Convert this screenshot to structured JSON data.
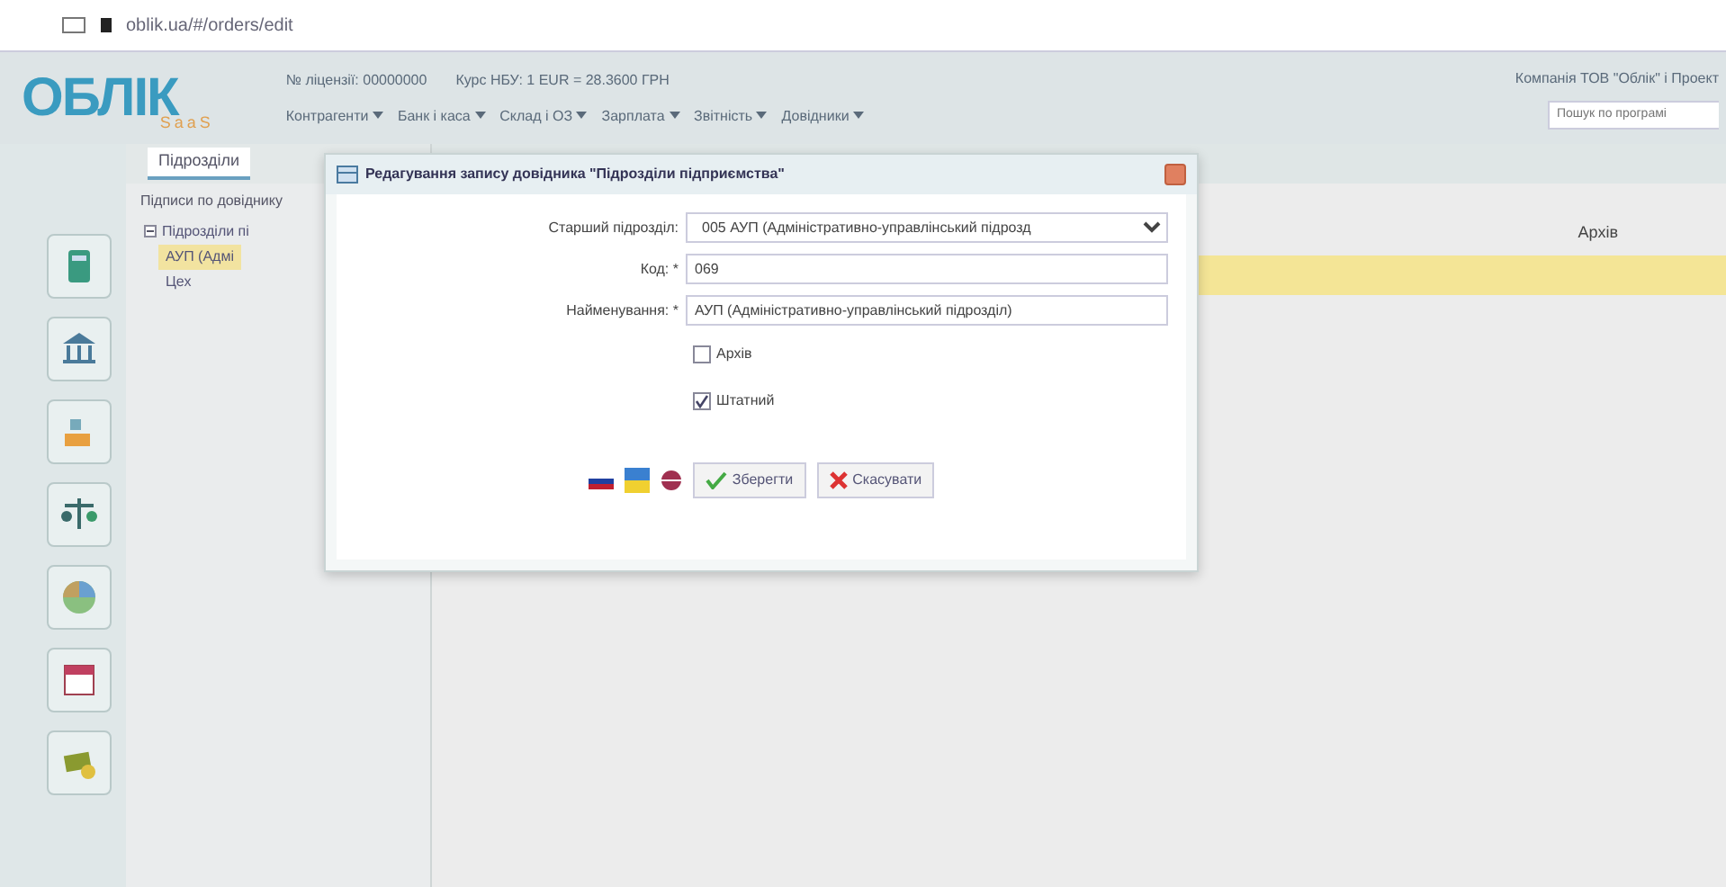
{
  "browser": {
    "address": "oblik.ua/#/orders/edit"
  },
  "header": {
    "logo": "ОБЛІК",
    "logo_sub": "SaaS",
    "license": "№ ліцензії: 00000000",
    "rate": "Курс НБУ: 1 EUR = 28.3600 ГРН",
    "menu": [
      "Контрагенти",
      "Банк і каса",
      "Склад і ОЗ",
      "Зарплата",
      "Звітність",
      "Довідники"
    ],
    "company": "Компанія ТОВ \"Облік\" і Проект",
    "search": {
      "placeholder": "Пошук по програмі"
    }
  },
  "tabs": [
    {
      "label": "Підрозділи",
      "selected": true
    }
  ],
  "tree": {
    "title": "Підписи по довіднику",
    "nodes": [
      {
        "label": "Підрозділи пі",
        "expanded": true,
        "selected": false,
        "children": [
          {
            "label": "АУП (Адмі",
            "selected": true
          },
          {
            "label": "Цех",
            "selected": false
          }
        ]
      }
    ]
  },
  "grid": {
    "columns": [
      "Архів"
    ],
    "rows": [
      {
        "selected": true
      }
    ]
  },
  "dialog": {
    "title": "Редагування запису довідника \"Підрозділи підприємства\"",
    "fields": [
      {
        "kind": "select",
        "label": "Старший підрозділ:",
        "value": "005 АУП (Адміністративно-управлінський підрозд"
      },
      {
        "kind": "text",
        "label": "Код: *",
        "value": "069"
      },
      {
        "kind": "text",
        "label": "Найменування: *",
        "value": "АУП (Адміністративно-управлінський підрозділ)"
      }
    ],
    "checks": [
      {
        "label": "Архів",
        "checked": false
      },
      {
        "label": "Штатний",
        "checked": true
      }
    ],
    "buttons": [
      {
        "kind": "save",
        "label": "Зберегти"
      },
      {
        "kind": "cancel",
        "label": "Скасувати"
      }
    ]
  }
}
